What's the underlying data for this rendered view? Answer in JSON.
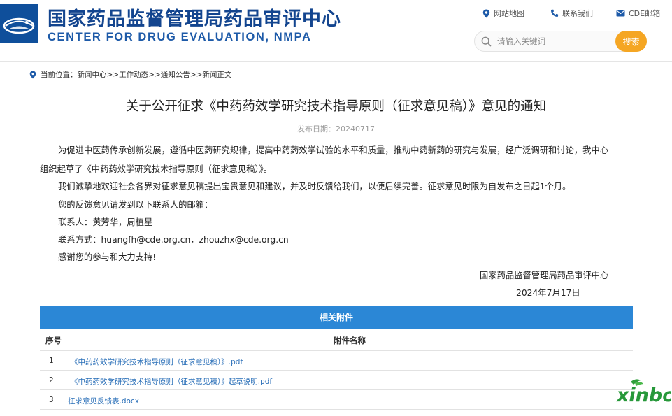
{
  "header": {
    "site_name_cn": "国家药品监督管理局药品审评中心",
    "site_name_en": "CENTER FOR DRUG EVALUATION, NMPA",
    "links": {
      "sitemap": "网站地图",
      "contact": "联系我们",
      "mail": "CDE邮箱"
    },
    "search": {
      "placeholder": "请输入关键词",
      "button": "搜索"
    }
  },
  "breadcrumb": {
    "label": "当前位置：",
    "items": [
      "新闻中心",
      "工作动态",
      "通知公告",
      "新闻正文"
    ],
    "separator": ">>"
  },
  "article": {
    "title": "关于公开征求《中药药效学研究技术指导原则（征求意见稿）》意见的通知",
    "date_label": "发布日期：",
    "date": "20240717",
    "para1_line1": "为促进中医药传承创新发展，遵循中医药研究规律，提高中药药效学试验的水平和质量，推动中药新药的研究与发展，经广泛调研和讨论，我中心",
    "para1_line2": "组织起草了《中药药效学研究技术指导原则（征求意见稿）》。",
    "para2": "我们诚挚地欢迎社会各界对征求意见稿提出宝贵意见和建议，并及时反馈给我们，以便后续完善。征求意见时限为自发布之日起1个月。",
    "para3": "您的反馈意见请发到以下联系人的邮箱：",
    "para4": "联系人：黄芳华，周植星",
    "para5": "联系方式：huangfh@cde.org.cn，zhouzhx@cde.org.cn",
    "para6": "感谢您的参与和大力支持!",
    "signature_org": "国家药品监督管理局药品审评中心",
    "signature_date": "2024年7月17日"
  },
  "attachments": {
    "title": "相关附件",
    "col_no": "序号",
    "col_name": "附件名称",
    "rows": [
      {
        "no": "1",
        "name": "《中药药效学研究技术指导原则（征求意见稿）》.pdf"
      },
      {
        "no": "2",
        "name": "《中药药效学研究技术指导原则（征求意见稿）》起草说明.pdf"
      },
      {
        "no": "3",
        "name": "征求意见反馈表.docx"
      }
    ]
  },
  "watermark": "xinbo",
  "colors": {
    "brand_blue": "#13458f",
    "accent_orange": "#f5a623",
    "table_header_blue": "#2b87d6",
    "link_blue": "#2a6fb8"
  }
}
